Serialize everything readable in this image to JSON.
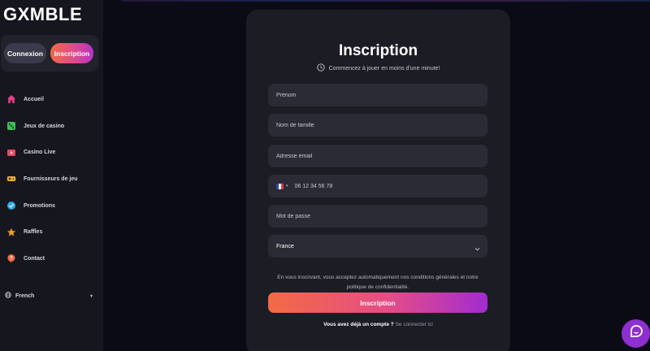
{
  "brand": {
    "logo_text": "GXMBLE"
  },
  "sidebar": {
    "login_label": "Connexion",
    "register_label": "Inscription",
    "items": [
      {
        "label": "Accueil",
        "icon": "home-icon",
        "color": "#e83e8c"
      },
      {
        "label": "Jeux de casino",
        "icon": "dice-icon",
        "color": "#3cc15a"
      },
      {
        "label": "Casino Live",
        "icon": "live-tv-icon",
        "color": "#e84a5f"
      },
      {
        "label": "Fournisseurs de jeu",
        "icon": "gamepad-icon",
        "color": "#f0b429"
      },
      {
        "label": "Promotions",
        "icon": "badge-check-icon",
        "color": "#2ea8f0"
      },
      {
        "label": "Raffles",
        "icon": "star-icon",
        "color": "#f0a020"
      },
      {
        "label": "Contact",
        "icon": "help-icon",
        "color": "#f06a45"
      }
    ],
    "language": {
      "label": "French"
    }
  },
  "form": {
    "title": "Inscription",
    "subtitle": "Commencez à jouer en moins d'une minute!",
    "first_name_placeholder": "Prénom",
    "last_name_placeholder": "Nom de famille",
    "email_placeholder": "Adresse email",
    "phone_placeholder": "06 12 34 56 78",
    "password_placeholder": "Mot de passe",
    "country_value": "France",
    "terms": "En vous inscrivant, vous acceptez automatiquement nos conditions générales et notre politique de confidentialité.",
    "submit_label": "Inscription",
    "login_question": "Vous avez déjà un compte ?",
    "login_link": "Se connecter ici"
  },
  "colors": {
    "accent_gradient_start": "#f36a44",
    "accent_gradient_end": "#a12cd0",
    "chat_button": "#8e2fd0"
  }
}
